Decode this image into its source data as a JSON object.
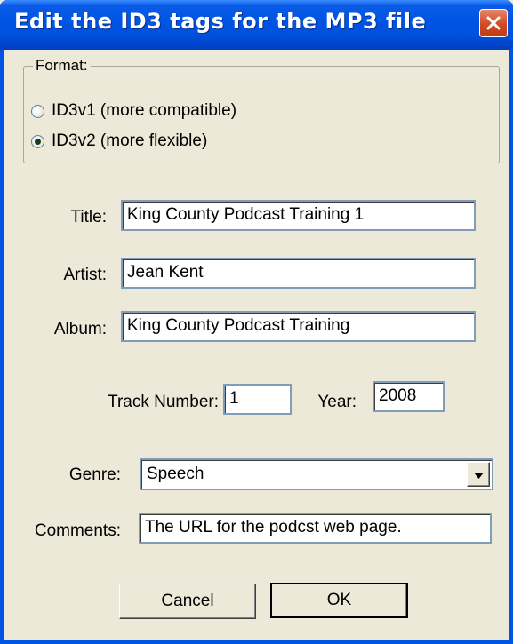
{
  "window": {
    "title": "Edit the ID3 tags for the MP3 file"
  },
  "format": {
    "legend": "Format:",
    "options": [
      {
        "label": "ID3v1 (more compatible)",
        "selected": false
      },
      {
        "label": "ID3v2 (more flexible)",
        "selected": true
      }
    ]
  },
  "fields": {
    "title": {
      "label": "Title:",
      "value": "King County Podcast Training 1"
    },
    "artist": {
      "label": "Artist:",
      "value": "Jean Kent"
    },
    "album": {
      "label": "Album:",
      "value": "King County Podcast Training"
    },
    "track": {
      "label": "Track Number:",
      "value": "1"
    },
    "year": {
      "label": "Year:",
      "value": "2008"
    },
    "genre": {
      "label": "Genre:",
      "value": "Speech"
    },
    "comments": {
      "label": "Comments:",
      "value": "The URL for the podcst web page."
    }
  },
  "buttons": {
    "cancel": "Cancel",
    "ok": "OK"
  },
  "icons": {
    "close": "close-icon",
    "dropdown": "chevron-down-icon"
  },
  "colors": {
    "titlebar": "#0055E5",
    "close": "#D24A22",
    "face": "#ECE9D8"
  }
}
